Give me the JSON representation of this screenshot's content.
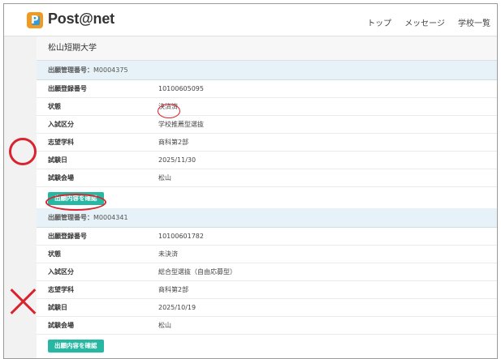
{
  "header": {
    "brand": "Post@net",
    "nav": [
      "トップ",
      "メッセージ",
      "学校一覧"
    ]
  },
  "school_name": "松山短期大学",
  "applications": [
    {
      "manage_label": "出願管理番号：",
      "manage_number": "M0004375",
      "rows": [
        {
          "label": "出願登録番号",
          "value": "10100605095"
        },
        {
          "label": "状態",
          "value": "決済済"
        },
        {
          "label": "入試区分",
          "value": "学校推薦型選抜"
        },
        {
          "label": "志望学科",
          "value": "商科第2部"
        },
        {
          "label": "試験日",
          "value": "2025/11/30"
        },
        {
          "label": "試験会場",
          "value": "松山"
        }
      ],
      "button": "出願内容を確認"
    },
    {
      "manage_label": "出願管理番号：",
      "manage_number": "M0004341",
      "rows": [
        {
          "label": "出願登録番号",
          "value": "10100601782"
        },
        {
          "label": "状態",
          "value": "未決済"
        },
        {
          "label": "入試区分",
          "value": "総合型選抜（自由応募型）"
        },
        {
          "label": "志望学科",
          "value": "商科第2部"
        },
        {
          "label": "試験日",
          "value": "2025/10/19"
        },
        {
          "label": "試験会場",
          "value": "松山"
        }
      ],
      "button": "出願内容を確認"
    }
  ],
  "colors": {
    "accent_button": "#27b7a3",
    "card_header": "#e6f2f7",
    "annotation_red": "#d9232e",
    "logo_orange": "#f29a1f",
    "logo_blue": "#2f9bd8"
  },
  "annotations": {
    "correct_mark": "circle-icon",
    "wrong_mark": "cross-icon"
  }
}
